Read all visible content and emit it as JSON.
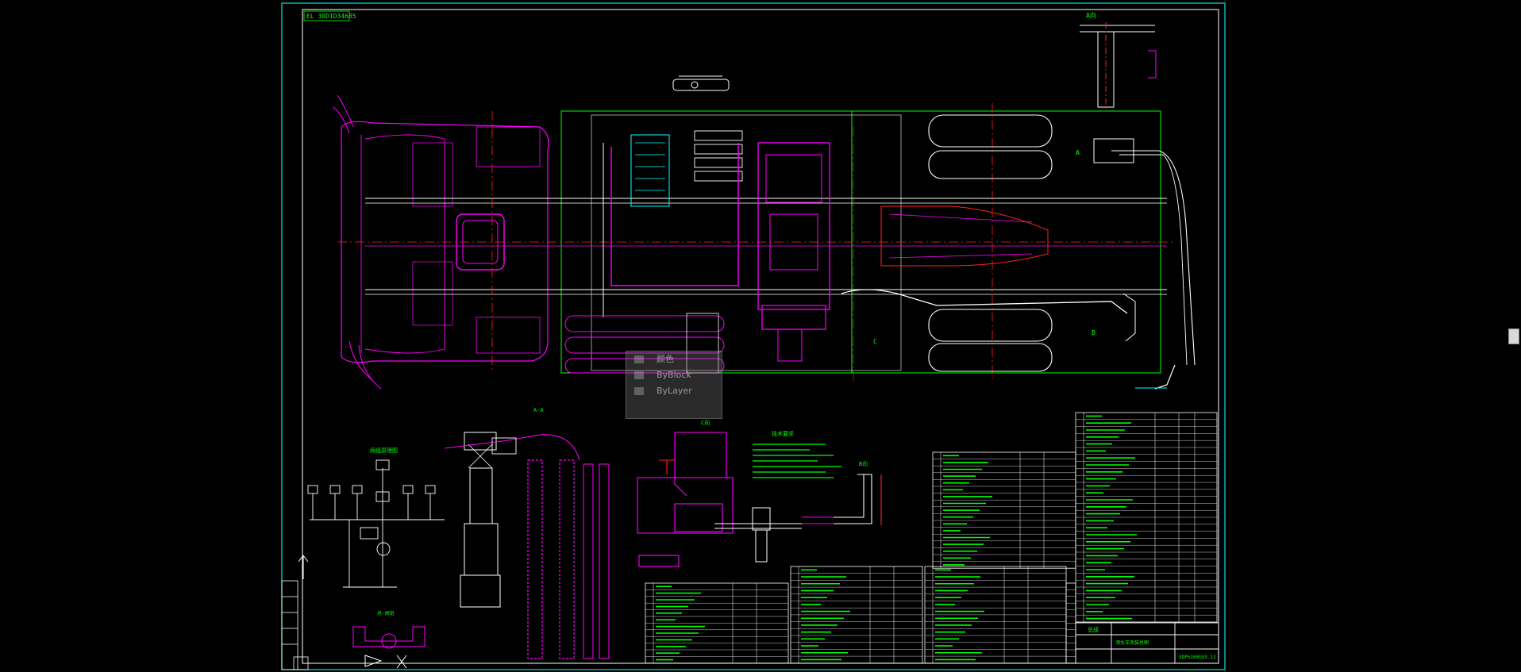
{
  "drawing": {
    "stamp": "EL 30D1D34685",
    "section_aa": "A-A",
    "view_a": "A向",
    "view_c": "C向",
    "view_b": "B向",
    "label_a": "A",
    "label_b": "B",
    "label_c": "C",
    "schematic_title": "阀组原理图",
    "note_title": "技术要求",
    "bottom_part_label": "总-阀组"
  },
  "context_menu": {
    "items": [
      {
        "label": "颜色"
      },
      {
        "label": "ByBlock"
      },
      {
        "label": "ByLayer"
      }
    ]
  },
  "title_block": {
    "drawing_name": "洒水车改装总图",
    "drawing_number": "SDP5160GSS.11",
    "company": "总成"
  },
  "colors": {
    "frame": "#00e5e5",
    "magenta": "#ff00ff",
    "green": "#00ff00",
    "red": "#ff2020",
    "white": "#ffffff",
    "yellow": "#ffff00",
    "cyan": "#00ffff"
  }
}
